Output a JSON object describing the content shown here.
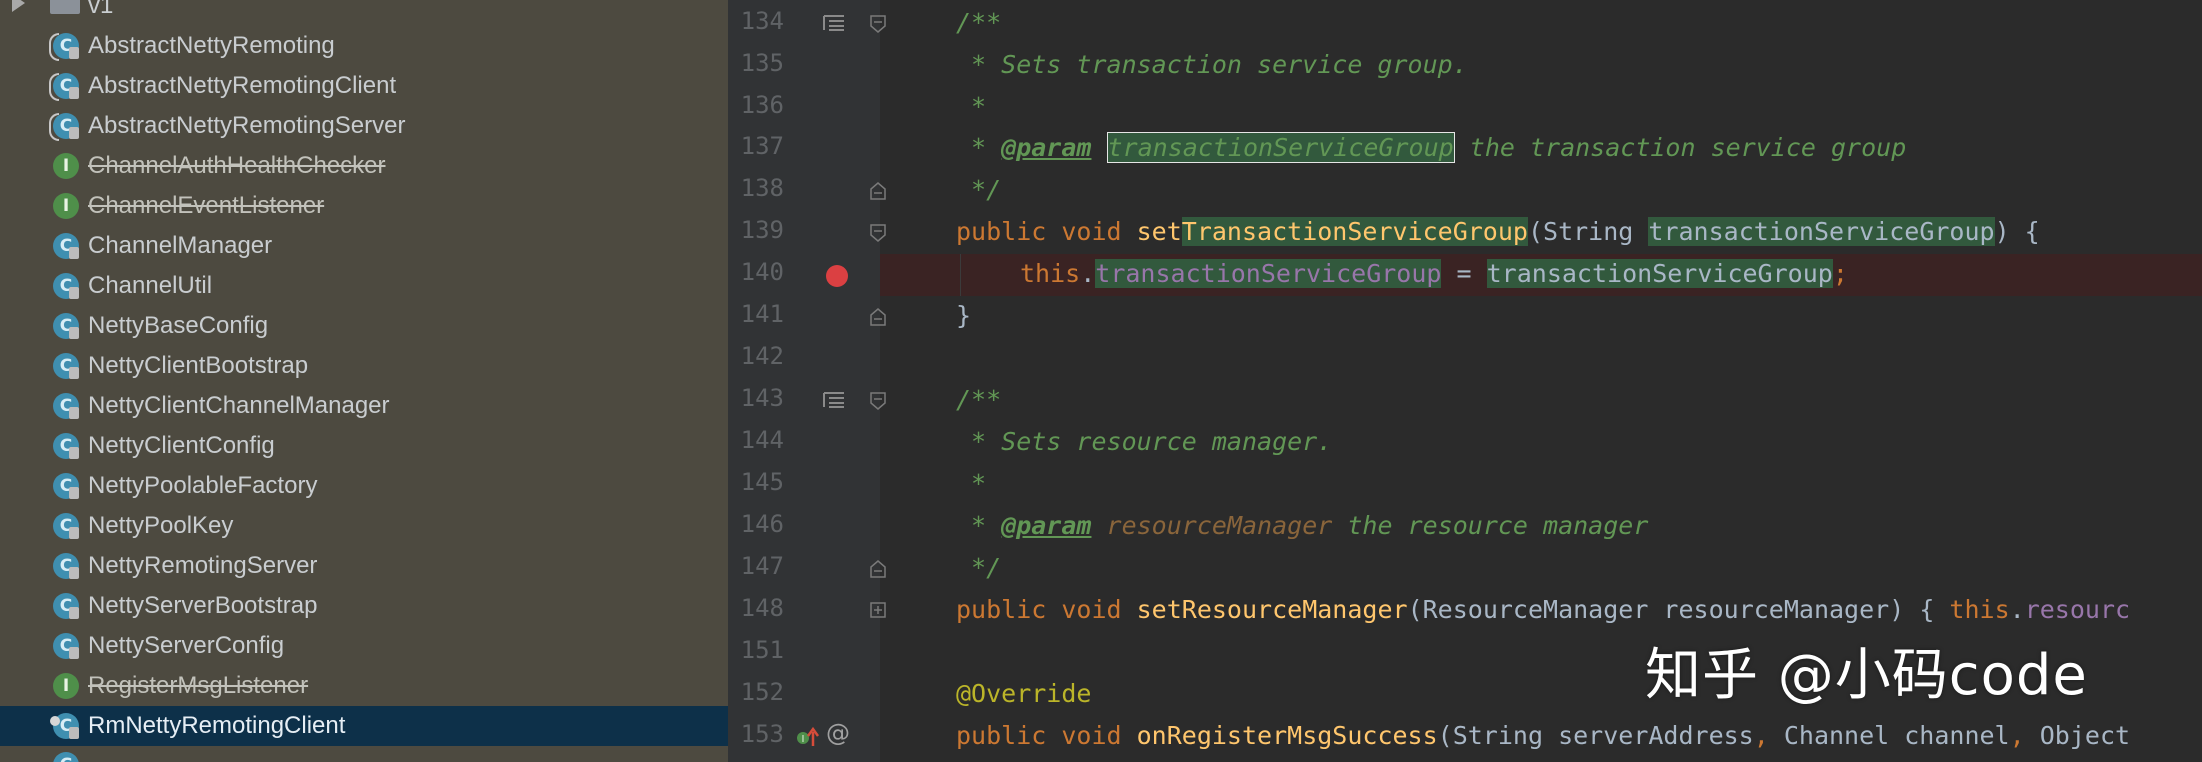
{
  "project_tree": {
    "partial_folder": "v1",
    "items": [
      {
        "label": "AbstractNettyRemoting",
        "kind": "abstract-class"
      },
      {
        "label": "AbstractNettyRemotingClient",
        "kind": "abstract-class"
      },
      {
        "label": "AbstractNettyRemotingServer",
        "kind": "abstract-class"
      },
      {
        "label": "ChannelAuthHealthChecker",
        "kind": "interface-deprecated"
      },
      {
        "label": "ChannelEventListener",
        "kind": "interface-deprecated"
      },
      {
        "label": "ChannelManager",
        "kind": "class"
      },
      {
        "label": "ChannelUtil",
        "kind": "class"
      },
      {
        "label": "NettyBaseConfig",
        "kind": "class"
      },
      {
        "label": "NettyClientBootstrap",
        "kind": "class"
      },
      {
        "label": "NettyClientChannelManager",
        "kind": "class"
      },
      {
        "label": "NettyClientConfig",
        "kind": "class"
      },
      {
        "label": "NettyPoolableFactory",
        "kind": "class"
      },
      {
        "label": "NettyPoolKey",
        "kind": "class"
      },
      {
        "label": "NettyRemotingServer",
        "kind": "class"
      },
      {
        "label": "NettyServerBootstrap",
        "kind": "class"
      },
      {
        "label": "NettyServerConfig",
        "kind": "class"
      },
      {
        "label": "RegisterMsgListener",
        "kind": "interface-deprecated"
      },
      {
        "label": "RmNettyRemotingClient",
        "kind": "class-selected"
      }
    ]
  },
  "editor": {
    "lines": [
      {
        "n": "134",
        "text": "/**"
      },
      {
        "n": "135",
        "text": " * Sets transaction service group."
      },
      {
        "n": "136",
        "text": " *"
      },
      {
        "n": "137",
        "star": " * ",
        "tag": "@param",
        "param": "transactionServiceGroup",
        "rest": " the transaction service group"
      },
      {
        "n": "138",
        "text": " */"
      },
      {
        "n": "139",
        "kw": "public void ",
        "fn1": "set",
        "fn2": "TransactionServiceGroup",
        "p1": "(String ",
        "arg": "transactionServiceGroup",
        "p2": ") {"
      },
      {
        "n": "140",
        "kw": "this",
        "dot": ".",
        "field": "transactionServiceGroup",
        "eq": " = ",
        "val": "transactionServiceGroup",
        "semi": ";"
      },
      {
        "n": "141",
        "text": "}"
      },
      {
        "n": "142",
        "text": ""
      },
      {
        "n": "143",
        "text": "/**"
      },
      {
        "n": "144",
        "text": " * Sets resource manager."
      },
      {
        "n": "145",
        "text": " *"
      },
      {
        "n": "146",
        "star": " * ",
        "tag": "@param",
        "param": "resourceManager",
        "rest": " the resource manager"
      },
      {
        "n": "147",
        "text": " */"
      },
      {
        "n": "148",
        "kw": "public void ",
        "fn": "setResourceManager",
        "params": "(ResourceManager resourceManager) ",
        "brace": "{ ",
        "kw2": "this",
        "dot": ".",
        "fld": "resourc"
      },
      {
        "n": "151",
        "text": ""
      },
      {
        "n": "152",
        "anno": "@Override"
      },
      {
        "n": "153",
        "kw": "public void ",
        "fn": "onRegisterMsgSuccess",
        "p1": "(String serverAddress",
        "c1": ", ",
        "p2": "Channel channel",
        "c2": ", ",
        "p3": "Object"
      }
    ]
  },
  "gutter_icons": [
    "doc-icon",
    "fold-icon",
    "breakpoint-icon",
    "implements-icon",
    "annotation-icon"
  ],
  "watermark": "知乎 @小码code",
  "colors": {
    "tree_bg": "#4d4a40",
    "selection": "#0d3049",
    "editor_bg": "#2b2b2b",
    "keyword": "#cc7832",
    "function": "#ffc66d",
    "doc_comment": "#629755",
    "field": "#9876aa",
    "breakpoint": "#db4042",
    "highlight": "#32593d"
  }
}
